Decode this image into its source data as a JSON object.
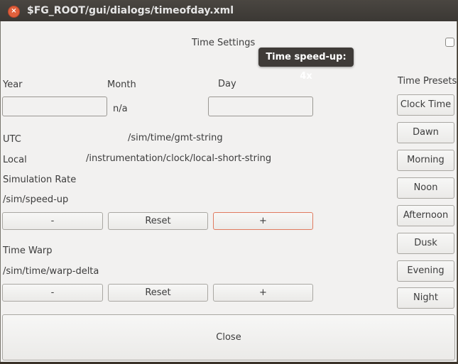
{
  "window": {
    "title": "$FG_ROOT/gui/dialogs/timeofday.xml",
    "close_icon": "×"
  },
  "dialog": {
    "heading": "Time Settings",
    "tooltip": "Time speed-up: 4x"
  },
  "date": {
    "year_label": "Year",
    "month_label": "Month",
    "day_label": "Day",
    "year_value": "",
    "month_value": "n/a",
    "day_value": ""
  },
  "times": {
    "utc_label": "UTC",
    "utc_value": "/sim/time/gmt-string",
    "local_label": "Local",
    "local_value": "/instrumentation/clock/local-short-string"
  },
  "sim_rate": {
    "label": "Simulation Rate",
    "property": "/sim/speed-up",
    "minus": "-",
    "reset": "Reset",
    "plus": "+"
  },
  "time_warp": {
    "label": "Time Warp",
    "property": "/sim/time/warp-delta",
    "minus": "-",
    "reset": "Reset",
    "plus": "+"
  },
  "presets": {
    "label": "Time Presets",
    "items": [
      "Clock Time",
      "Dawn",
      "Morning",
      "Noon",
      "Afternoon",
      "Dusk",
      "Evening",
      "Night"
    ]
  },
  "close_label": "Close"
}
